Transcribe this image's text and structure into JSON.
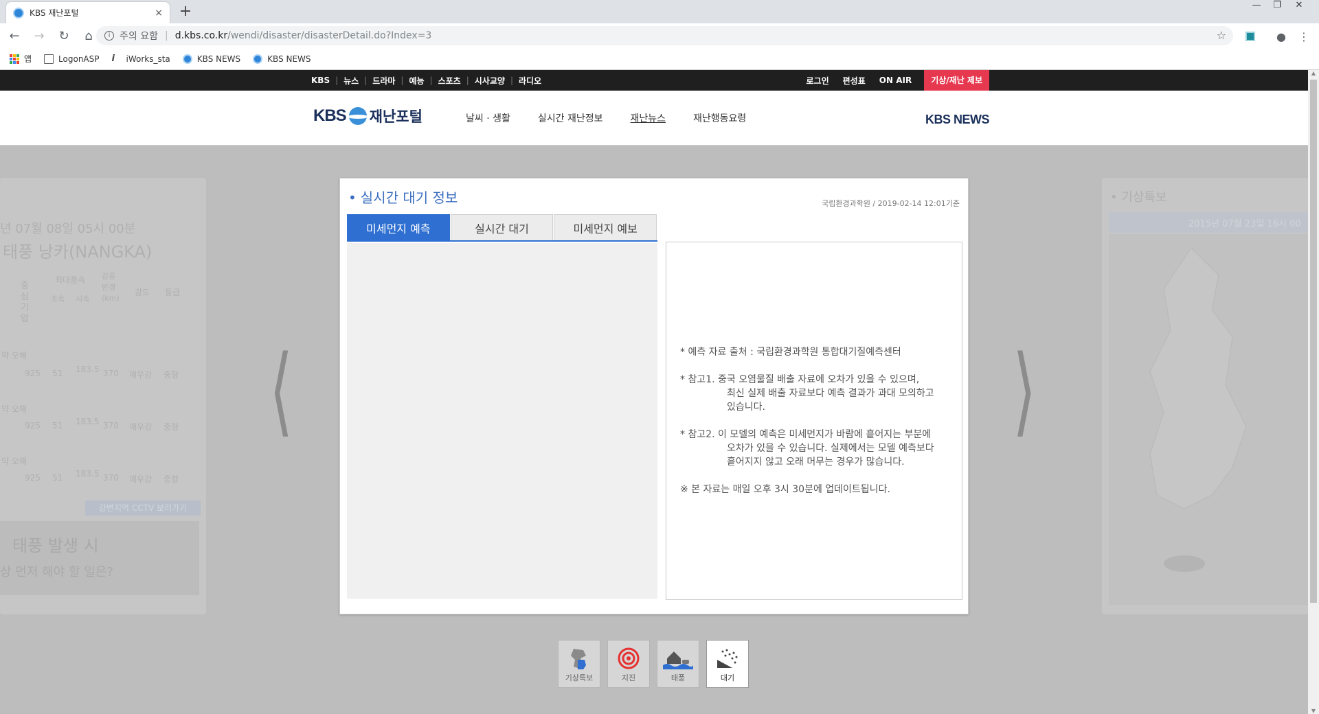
{
  "browser": {
    "tab_title": "KBS 재난포털",
    "tab_close": "×",
    "new_tab": "+",
    "security_label": "주의 요함",
    "url_host": "d.kbs.co.kr",
    "url_path": "/wendi/disaster/disasterDetail.do?Index=3",
    "bookmarks": [
      {
        "label": "앱",
        "icon": "apps-icon"
      },
      {
        "label": "LogonASP",
        "icon": "page-icon"
      },
      {
        "label": "iWorks_sta",
        "icon": "iworks-icon"
      },
      {
        "label": "KBS NEWS",
        "icon": "kbs-icon"
      },
      {
        "label": "KBS NEWS",
        "icon": "kbs-icon"
      }
    ]
  },
  "gnb": {
    "left": [
      "KBS",
      "뉴스",
      "드라마",
      "예능",
      "스포츠",
      "시사교양",
      "라디오"
    ],
    "right": [
      "로그인",
      "편성표",
      "ON AIR"
    ],
    "report_label": "기상/재난 제보",
    "report_color": "#e6384f"
  },
  "header": {
    "logo_kbs": "KBS",
    "logo_name": "재난포털",
    "nav": [
      "날씨 · 생활",
      "실시간 재난정보",
      "재난뉴스",
      "재난행동요령"
    ],
    "active_nav": "재난뉴스",
    "kbs_news": "KBS NEWS"
  },
  "ghost_left": {
    "date": "년 07월 08일 05시 00분",
    "typhoon": "태풍 낭카(NANGKA)",
    "col_center_pressure": "중심 기압",
    "col_max_wind": "최대풍속",
    "col_sub_ms": "초속",
    "col_sub_kmh": "시속",
    "col_radius": "강풍 반경 (km)",
    "col_strength": "강도",
    "col_grade": "등급",
    "rows": [
      {
        "pos": "약 오해",
        "pressure": "925",
        "ms": "51",
        "kmh": "183.5",
        "radius": "370",
        "strength": "매우강",
        "grade": "중형"
      },
      {
        "pos": "약 오해",
        "pressure": "925",
        "ms": "51",
        "kmh": "183.5",
        "radius": "370",
        "strength": "매우강",
        "grade": "중형"
      },
      {
        "pos": "약 오해",
        "pressure": "925",
        "ms": "51",
        "kmh": "183.5",
        "radius": "370",
        "strength": "매우강",
        "grade": "중형"
      }
    ],
    "cctv_button": "강변지역 CCTV 보러가기",
    "banner_title": "태풍 발생 시",
    "banner_sub": "상 먼저 해야 할 일은?"
  },
  "ghost_right": {
    "title": "• 기상특보",
    "date": "2015년 07월 23일 16시 00"
  },
  "card": {
    "title": "실시간 대기 정보",
    "source": "국립환경과학원 / 2019-02-14 12:01기준",
    "tabs": [
      "미세먼지 예측",
      "실시간 대기",
      "미세먼지 예보"
    ],
    "active_tab": "미세먼지 예측",
    "notes": [
      {
        "first": "* 예측 자료 출처 : 국립환경과학원 통합대기질예측센터",
        "rest": []
      },
      {
        "first": "* 참고1. 중국 오염물질 배출 자료에 오차가 있을 수 있으며,",
        "rest": [
          "최신 실제 배출 자료보다 예측 결과가 과대 모의하고",
          "있습니다."
        ]
      },
      {
        "first": "* 참고2. 이 모델의 예측은 미세먼지가 바람에 흩어지는 부분에",
        "rest": [
          "오차가 있을 수 있습니다. 실제에서는 모델 예측보다",
          "흩어지지 않고 오래 머무는 경우가 많습니다."
        ]
      },
      {
        "first": "※ 본 자료는 매일 오후 3시 30분에 업데이트됩니다.",
        "rest": []
      }
    ]
  },
  "categories": [
    {
      "label": "기상특보",
      "icon": "korea-map-icon"
    },
    {
      "label": "지진",
      "icon": "target-icon"
    },
    {
      "label": "태풍",
      "icon": "flood-house-icon"
    },
    {
      "label": "대기",
      "icon": "dust-icon"
    }
  ],
  "active_category": "대기"
}
